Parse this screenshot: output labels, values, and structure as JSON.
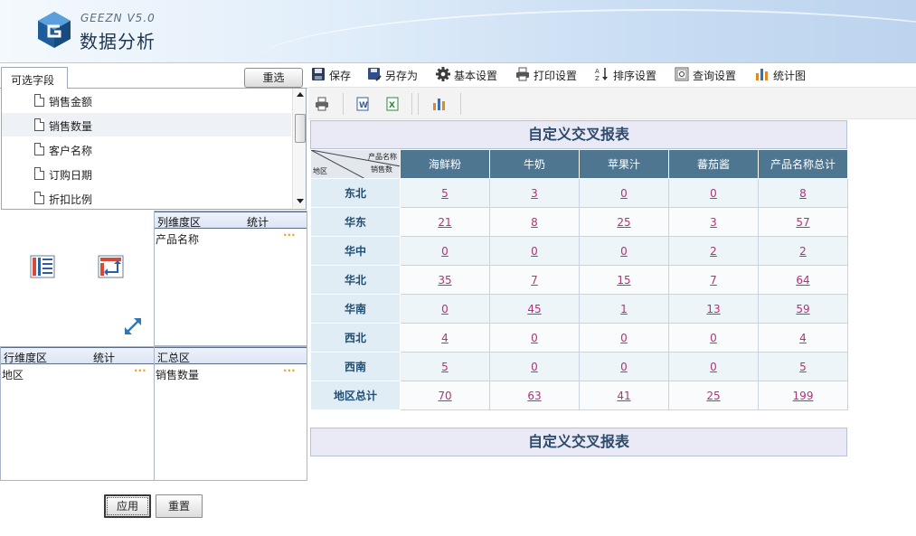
{
  "header": {
    "brand": "GEEZN  V5.0",
    "title": "数据分析"
  },
  "fields_panel": {
    "tab_label": "可选字段",
    "reset_label": "重选",
    "items": [
      "销售金额",
      "销售数量",
      "客户名称",
      "订购日期",
      "折扣比例"
    ],
    "selected_index": 1
  },
  "column_zone": {
    "title": "列维度区",
    "stat": "统计",
    "item": "产品名称",
    "dots": "···"
  },
  "row_zone": {
    "title": "行维度区",
    "stat": "统计",
    "item": "地区",
    "dots": "···"
  },
  "summary_zone": {
    "title": "汇总区",
    "item": "销售数量",
    "dots": "···"
  },
  "bottom_buttons": {
    "apply": "应用",
    "reset": "重置"
  },
  "toolbar": {
    "save": "保存",
    "save_as": "另存为",
    "basic_settings": "基本设置",
    "print_settings": "打印设置",
    "sort_settings": "排序设置",
    "query_settings": "查询设置",
    "chart": "统计图"
  },
  "report": {
    "title": "自定义交叉报表",
    "title_bottom": "自定义交叉报表",
    "corner_col": "产品名称",
    "corner_val": "销售数",
    "corner_row": "地区",
    "columns": [
      "海鲜粉",
      "牛奶",
      "苹果汁",
      "蕃茄酱",
      "产品名称总计"
    ],
    "rows": [
      {
        "label": "东北",
        "values": [
          "5",
          "3",
          "0",
          "0",
          "8"
        ]
      },
      {
        "label": "华东",
        "values": [
          "21",
          "8",
          "25",
          "3",
          "57"
        ]
      },
      {
        "label": "华中",
        "values": [
          "0",
          "0",
          "0",
          "2",
          "2"
        ]
      },
      {
        "label": "华北",
        "values": [
          "35",
          "7",
          "15",
          "7",
          "64"
        ]
      },
      {
        "label": "华南",
        "values": [
          "0",
          "45",
          "1",
          "13",
          "59"
        ]
      },
      {
        "label": "西北",
        "values": [
          "4",
          "0",
          "0",
          "0",
          "4"
        ]
      },
      {
        "label": "西南",
        "values": [
          "5",
          "0",
          "0",
          "0",
          "5"
        ]
      },
      {
        "label": "地区总计",
        "values": [
          "70",
          "63",
          "41",
          "25",
          "199"
        ]
      }
    ]
  },
  "colors": {
    "header_cell": "#4e7691",
    "row_label": "#1f4e75",
    "value_link": "#b5307d",
    "title_text": "#2d4c6c"
  }
}
